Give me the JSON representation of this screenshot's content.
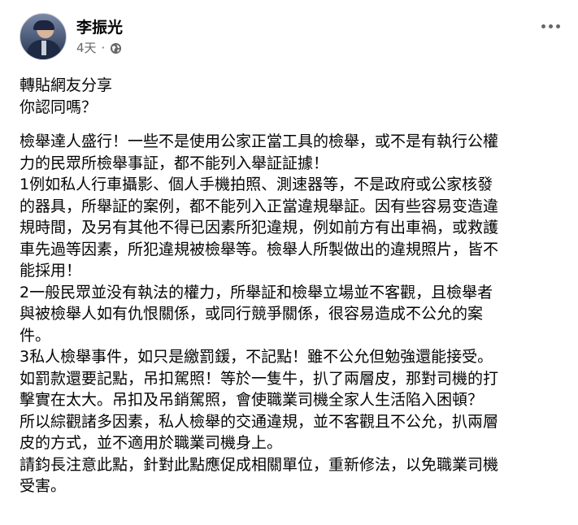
{
  "post": {
    "author": "李振光",
    "time": "4天",
    "separator": "·",
    "privacy_icon": "globe-icon",
    "menu_icon": "more-options-icon",
    "intro_lines": [
      "轉貼網友分享",
      "你認同嗎？"
    ],
    "body_lines": [
      "檢舉達人盛行！一些不是使用公家正當工具的檢舉，或不是有執行公權",
      "力的民眾所檢舉事証，都不能列入舉証証據！",
      "1例如私人行車攝影、個人手機拍照、測速器等，不是政府或公家核發",
      "的器具，所舉証的案例，都不能列入正當違規舉証。因有些容易变造違",
      "規時間，及另有其他不得已因素所犯違規，例如前方有出車禍，或救護",
      "車先過等因素，所犯違規被檢舉等。檢舉人所製做出的違規照片，皆不",
      "能採用！",
      "2一般民眾並没有執法的權力，所舉証和檢舉立場並不客觀，且檢舉者",
      "與被檢舉人如有仇恨關係，或同行競爭關係，很容易造成不公允的案",
      "件。",
      "3私人檢舉事件，如只是繳罰鍰，不記點！雖不公允但勉強還能接受。",
      "如罰款還要記點，吊扣駕照！等於一隻牛，扒了兩層皮，那對司機的打",
      "擊實在太大。吊扣及吊銷駕照，會使職業司機全家人生活陷入困頓？",
      "所以綜觀諸多因素，私人檢舉的交通違規，並不客觀且不公允，扒兩層",
      "皮的方式，並不適用於職業司機身上。",
      "請鈞長注意此點，針對此點應促成相關單位，重新修法，以免職業司機",
      "受害。"
    ]
  }
}
